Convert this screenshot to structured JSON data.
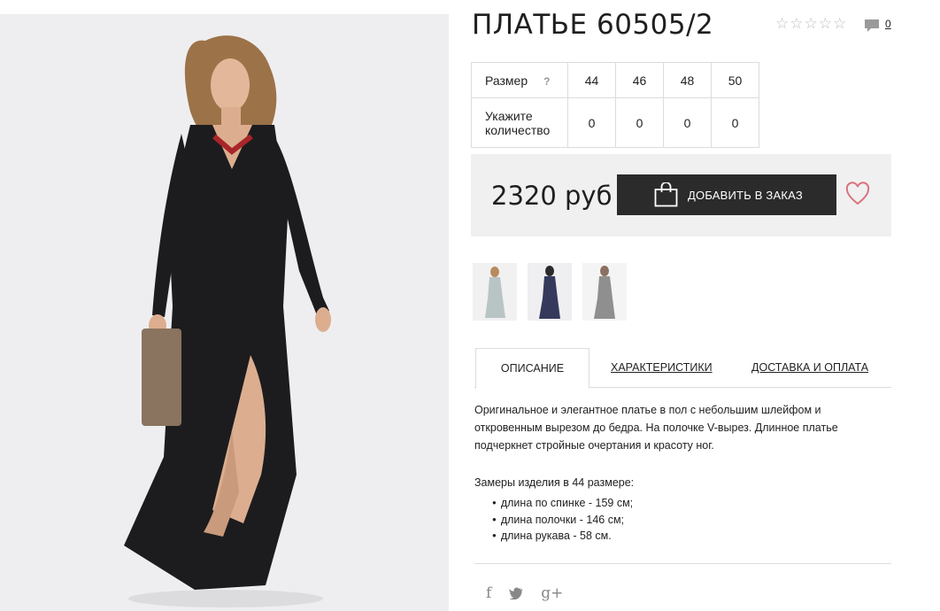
{
  "product": {
    "title": "ПЛАТЬЕ 60505/2",
    "rating_stars": 0,
    "rating_max": 5,
    "comment_count": "0"
  },
  "sizes": {
    "size_label": "Размер",
    "help": "?",
    "quantity_label": "Укажите количество",
    "items": [
      {
        "size": "44",
        "qty": "0"
      },
      {
        "size": "46",
        "qty": "0"
      },
      {
        "size": "48",
        "qty": "0"
      },
      {
        "size": "50",
        "qty": "0"
      }
    ]
  },
  "purchase": {
    "price": "2320 руб",
    "add_button_label": "ДОБАВИТЬ В ЗАКАЗ",
    "icons": [
      "shopping-bag-icon",
      "heart-icon"
    ]
  },
  "tabs": [
    {
      "label": "ОПИСАНИЕ",
      "active": true
    },
    {
      "label": "ХАРАКТЕРИСТИКИ",
      "active": false
    },
    {
      "label": "ДОСТАВКА И ОПЛАТА",
      "active": false
    }
  ],
  "description": {
    "text": "Оригинальное и элегантное платье в пол с небольшим шлейфом и откровенным вырезом до бедра. На полочке V-вырез. Длинное платье подчеркнет стройные очертания и красоту ног.",
    "measures_title": "Замеры изделия в 44 размере:",
    "measures": [
      "длина по спинке - 159 см;",
      "длина полочки - 146 см;",
      "длина рукава - 58 см."
    ]
  },
  "social": {
    "icons": [
      "facebook-icon",
      "twitter-icon",
      "google-plus-icon"
    ],
    "glyphs": [
      "f",
      "🐦",
      "g+"
    ]
  },
  "colors": {
    "button_bg": "#2b2b2b",
    "price_box_bg": "#f0f0f0",
    "heart": "#d9737d",
    "image_bg": "#efeff1"
  }
}
